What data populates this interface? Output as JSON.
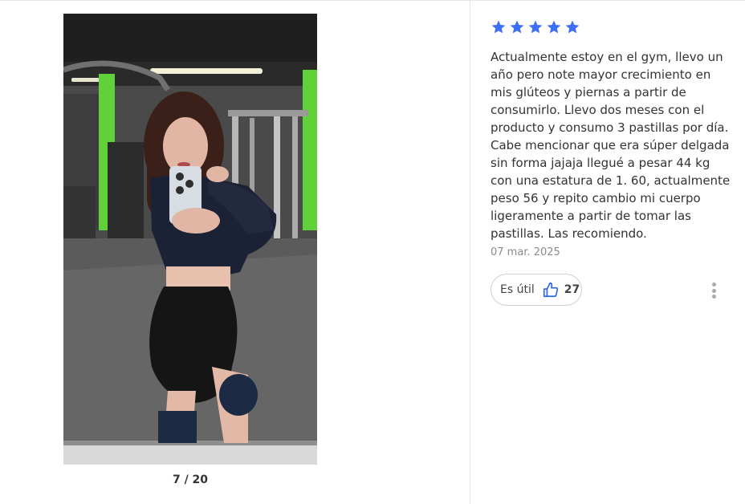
{
  "gallery": {
    "counter": "7 / 20",
    "photo_icon": "mirror-selfie-photo"
  },
  "review": {
    "rating": 5,
    "max_rating": 5,
    "star_color": "#3d6ff5",
    "text": "Actualmente estoy en el gym, llevo un año pero note mayor crecimiento en mis glúteos y piernas a partir de consumirlo. Llevo dos meses con el producto y consumo 3 pastillas por día. Cabe mencionar que era súper delgada sin forma jajaja llegué a pesar 44 kg con una estatura de 1. 60, actualmente peso 56 y repito cambio mi cuerpo ligeramente a partir de tomar las pastillas. Las recomiendo.",
    "date": "07 mar. 2025",
    "helpful": {
      "label": "Es útil",
      "count": "27",
      "icon": "thumbs-up-icon",
      "icon_color": "#2f63e8"
    },
    "more_icon": "more-vertical-icon"
  }
}
